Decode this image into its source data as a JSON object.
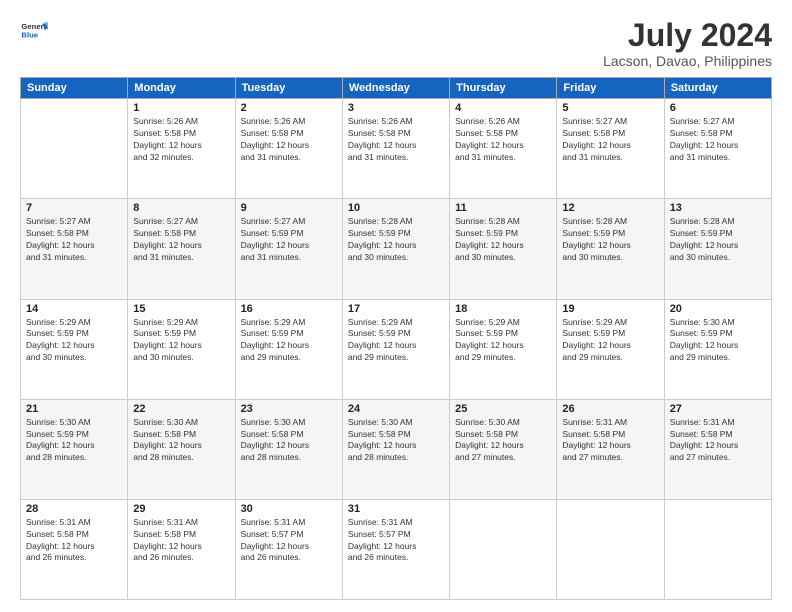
{
  "logo": {
    "line1": "General",
    "line2": "Blue"
  },
  "title": "July 2024",
  "subtitle": "Lacson, Davao, Philippines",
  "weekdays": [
    "Sunday",
    "Monday",
    "Tuesday",
    "Wednesday",
    "Thursday",
    "Friday",
    "Saturday"
  ],
  "weeks": [
    [
      {
        "day": "",
        "info": ""
      },
      {
        "day": "1",
        "info": "Sunrise: 5:26 AM\nSunset: 5:58 PM\nDaylight: 12 hours\nand 32 minutes."
      },
      {
        "day": "2",
        "info": "Sunrise: 5:26 AM\nSunset: 5:58 PM\nDaylight: 12 hours\nand 31 minutes."
      },
      {
        "day": "3",
        "info": "Sunrise: 5:26 AM\nSunset: 5:58 PM\nDaylight: 12 hours\nand 31 minutes."
      },
      {
        "day": "4",
        "info": "Sunrise: 5:26 AM\nSunset: 5:58 PM\nDaylight: 12 hours\nand 31 minutes."
      },
      {
        "day": "5",
        "info": "Sunrise: 5:27 AM\nSunset: 5:58 PM\nDaylight: 12 hours\nand 31 minutes."
      },
      {
        "day": "6",
        "info": "Sunrise: 5:27 AM\nSunset: 5:58 PM\nDaylight: 12 hours\nand 31 minutes."
      }
    ],
    [
      {
        "day": "7",
        "info": "Sunrise: 5:27 AM\nSunset: 5:58 PM\nDaylight: 12 hours\nand 31 minutes."
      },
      {
        "day": "8",
        "info": "Sunrise: 5:27 AM\nSunset: 5:58 PM\nDaylight: 12 hours\nand 31 minutes."
      },
      {
        "day": "9",
        "info": "Sunrise: 5:27 AM\nSunset: 5:59 PM\nDaylight: 12 hours\nand 31 minutes."
      },
      {
        "day": "10",
        "info": "Sunrise: 5:28 AM\nSunset: 5:59 PM\nDaylight: 12 hours\nand 30 minutes."
      },
      {
        "day": "11",
        "info": "Sunrise: 5:28 AM\nSunset: 5:59 PM\nDaylight: 12 hours\nand 30 minutes."
      },
      {
        "day": "12",
        "info": "Sunrise: 5:28 AM\nSunset: 5:59 PM\nDaylight: 12 hours\nand 30 minutes."
      },
      {
        "day": "13",
        "info": "Sunrise: 5:28 AM\nSunset: 5:59 PM\nDaylight: 12 hours\nand 30 minutes."
      }
    ],
    [
      {
        "day": "14",
        "info": "Sunrise: 5:29 AM\nSunset: 5:59 PM\nDaylight: 12 hours\nand 30 minutes."
      },
      {
        "day": "15",
        "info": "Sunrise: 5:29 AM\nSunset: 5:59 PM\nDaylight: 12 hours\nand 30 minutes."
      },
      {
        "day": "16",
        "info": "Sunrise: 5:29 AM\nSunset: 5:59 PM\nDaylight: 12 hours\nand 29 minutes."
      },
      {
        "day": "17",
        "info": "Sunrise: 5:29 AM\nSunset: 5:59 PM\nDaylight: 12 hours\nand 29 minutes."
      },
      {
        "day": "18",
        "info": "Sunrise: 5:29 AM\nSunset: 5:59 PM\nDaylight: 12 hours\nand 29 minutes."
      },
      {
        "day": "19",
        "info": "Sunrise: 5:29 AM\nSunset: 5:59 PM\nDaylight: 12 hours\nand 29 minutes."
      },
      {
        "day": "20",
        "info": "Sunrise: 5:30 AM\nSunset: 5:59 PM\nDaylight: 12 hours\nand 29 minutes."
      }
    ],
    [
      {
        "day": "21",
        "info": "Sunrise: 5:30 AM\nSunset: 5:59 PM\nDaylight: 12 hours\nand 28 minutes."
      },
      {
        "day": "22",
        "info": "Sunrise: 5:30 AM\nSunset: 5:58 PM\nDaylight: 12 hours\nand 28 minutes."
      },
      {
        "day": "23",
        "info": "Sunrise: 5:30 AM\nSunset: 5:58 PM\nDaylight: 12 hours\nand 28 minutes."
      },
      {
        "day": "24",
        "info": "Sunrise: 5:30 AM\nSunset: 5:58 PM\nDaylight: 12 hours\nand 28 minutes."
      },
      {
        "day": "25",
        "info": "Sunrise: 5:30 AM\nSunset: 5:58 PM\nDaylight: 12 hours\nand 27 minutes."
      },
      {
        "day": "26",
        "info": "Sunrise: 5:31 AM\nSunset: 5:58 PM\nDaylight: 12 hours\nand 27 minutes."
      },
      {
        "day": "27",
        "info": "Sunrise: 5:31 AM\nSunset: 5:58 PM\nDaylight: 12 hours\nand 27 minutes."
      }
    ],
    [
      {
        "day": "28",
        "info": "Sunrise: 5:31 AM\nSunset: 5:58 PM\nDaylight: 12 hours\nand 26 minutes."
      },
      {
        "day": "29",
        "info": "Sunrise: 5:31 AM\nSunset: 5:58 PM\nDaylight: 12 hours\nand 26 minutes."
      },
      {
        "day": "30",
        "info": "Sunrise: 5:31 AM\nSunset: 5:57 PM\nDaylight: 12 hours\nand 26 minutes."
      },
      {
        "day": "31",
        "info": "Sunrise: 5:31 AM\nSunset: 5:57 PM\nDaylight: 12 hours\nand 26 minutes."
      },
      {
        "day": "",
        "info": ""
      },
      {
        "day": "",
        "info": ""
      },
      {
        "day": "",
        "info": ""
      }
    ]
  ]
}
